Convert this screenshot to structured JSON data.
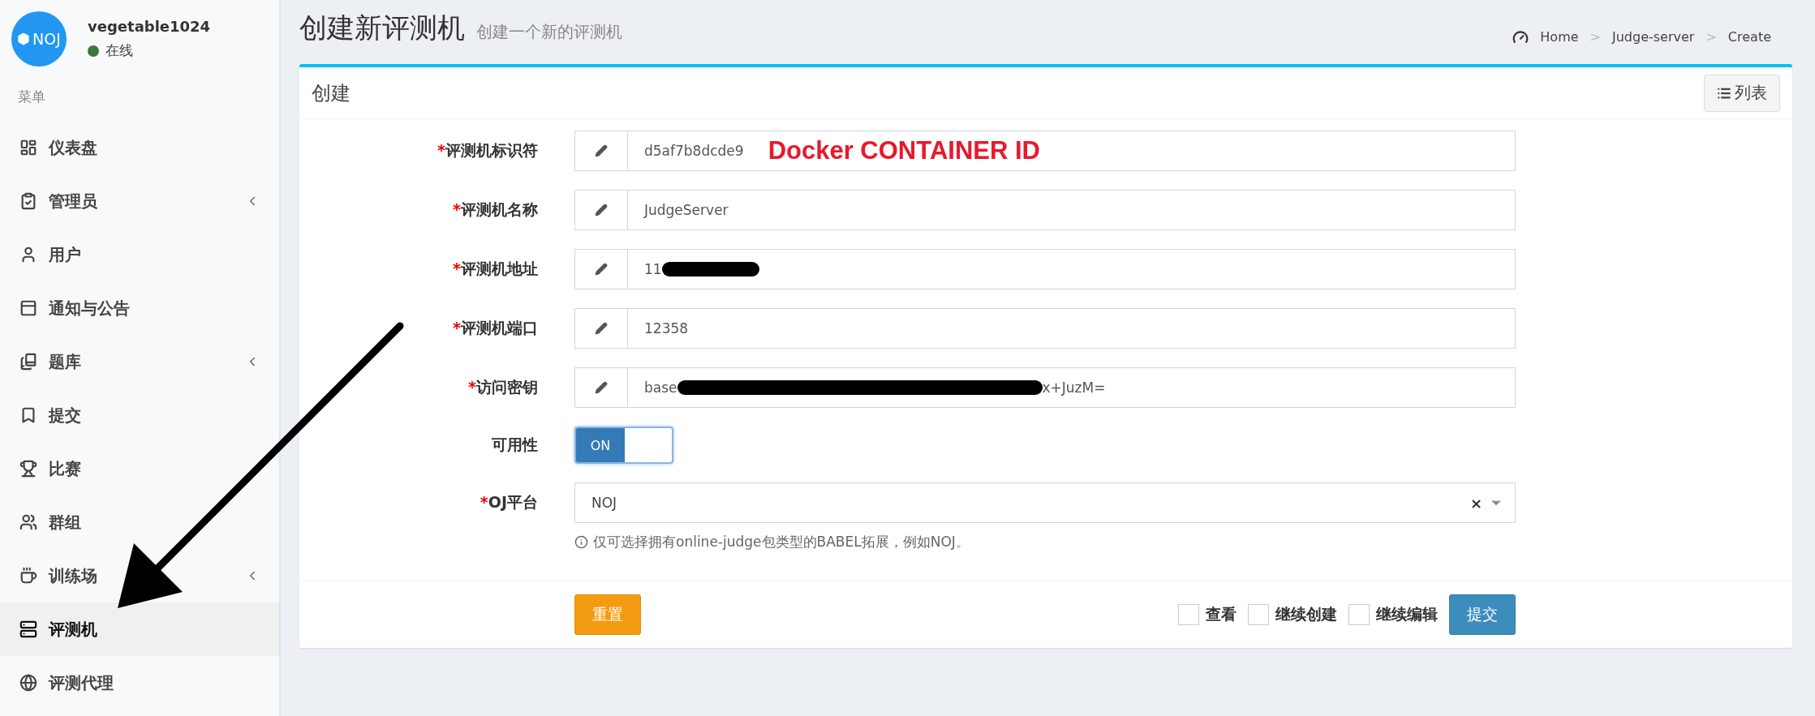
{
  "sidebar": {
    "logo": "NOJ",
    "user": {
      "name": "vegetable1024",
      "status": "在线",
      "online": true
    },
    "menu_header": "菜单",
    "items": [
      {
        "label": "仪表盘",
        "expandable": false,
        "selected": false
      },
      {
        "label": "管理员",
        "expandable": true,
        "selected": false
      },
      {
        "label": "用户",
        "expandable": false,
        "selected": false
      },
      {
        "label": "通知与公告",
        "expandable": false,
        "selected": false
      },
      {
        "label": "题库",
        "expandable": true,
        "selected": false
      },
      {
        "label": "提交",
        "expandable": false,
        "selected": false
      },
      {
        "label": "比赛",
        "expandable": false,
        "selected": false
      },
      {
        "label": "群组",
        "expandable": false,
        "selected": false
      },
      {
        "label": "训练场",
        "expandable": true,
        "selected": false
      },
      {
        "label": "评测机",
        "expandable": false,
        "selected": true
      },
      {
        "label": "评测代理",
        "expandable": false,
        "selected": false
      }
    ]
  },
  "header": {
    "title": "创建新评测机",
    "subtitle": "创建一个新的评测机",
    "breadcrumb": [
      "Home",
      "Judge-server",
      "Create"
    ],
    "breadcrumb_separator": ">"
  },
  "card": {
    "title": "创建",
    "list_button": "列表",
    "fields": [
      {
        "kind": "text",
        "label": "评测机标识符",
        "required_mark": "*",
        "value": "d5af7b8dcde9",
        "redacted": false,
        "note": "Docker CONTAINER ID"
      },
      {
        "kind": "text",
        "label": "评测机名称",
        "required_mark": "*",
        "value": "JudgeServer",
        "redacted": false
      },
      {
        "kind": "text",
        "label": "评测机地址",
        "required_mark": "*",
        "value": "11",
        "redacted": true
      },
      {
        "kind": "text",
        "label": "评测机端口",
        "required_mark": "*",
        "value": "12358",
        "redacted": false
      },
      {
        "kind": "text",
        "label": "访问密钥",
        "required_mark": "*",
        "value": "base",
        "redacted": true,
        "value_after": "x+JuzM="
      },
      {
        "kind": "toggle",
        "label": "可用性",
        "on": true,
        "on_label": "ON"
      },
      {
        "kind": "select",
        "label": "OJ平台",
        "required_mark": "*",
        "value": "NOJ",
        "clear": "×",
        "help": "仅可选择拥有online-judge包类型的BABEL拓展，例如NOJ。"
      }
    ],
    "reset_button": "重置",
    "options": [
      {
        "label": "查看",
        "checked": false
      },
      {
        "label": "继续创建",
        "checked": false
      },
      {
        "label": "继续编辑",
        "checked": false
      }
    ],
    "submit_button": "提交"
  }
}
